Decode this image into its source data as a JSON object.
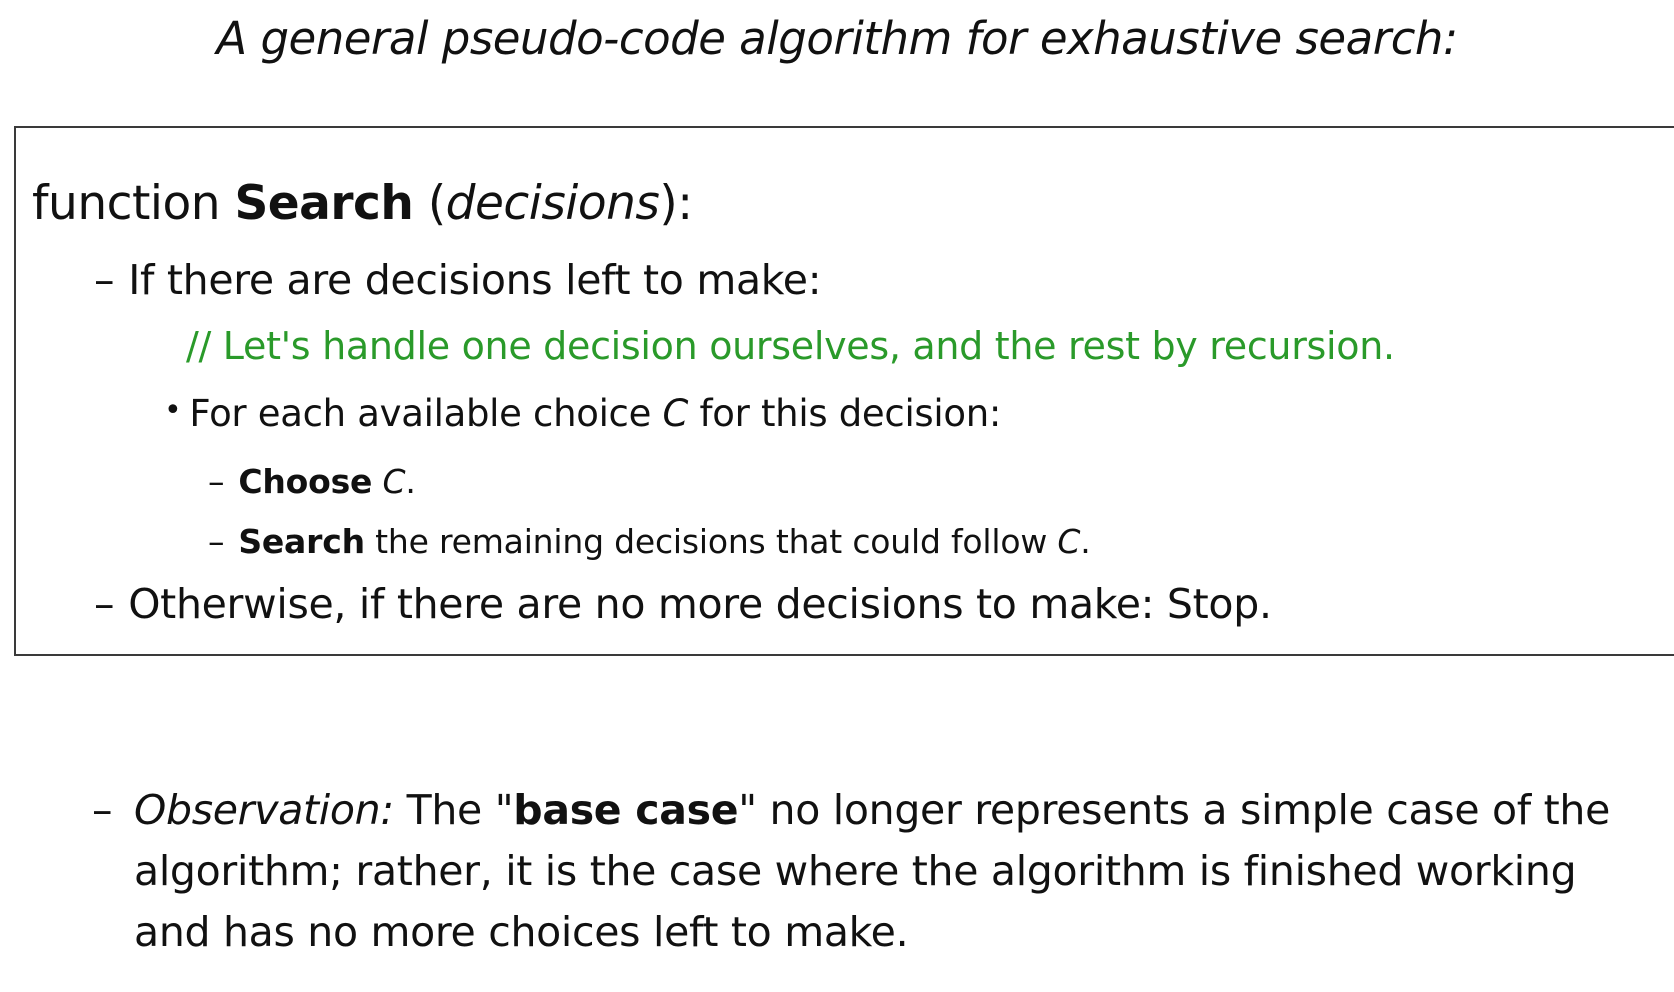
{
  "title": "A general pseudo-code algorithm for exhaustive search:",
  "code": {
    "function_keyword": "function ",
    "function_name": "Search",
    "paren_open": " (",
    "param": "decisions",
    "paren_close": "):",
    "dash": "–",
    "bullet": "•",
    "if_line": "If there are decisions left to make:",
    "comment": "// Let's handle one decision ourselves, and the rest by recursion.",
    "for_line_prefix": "For each available choice ",
    "for_var": "C",
    "for_line_suffix": " for this decision:",
    "choose_bold": "Choose",
    "choose_space": " ",
    "choose_var": "C",
    "choose_end": ".",
    "search_bold": "Search",
    "search_text": " the remaining decisions that could follow ",
    "search_var": "C",
    "search_end": ".",
    "otherwise_line": "Otherwise, if there are no more decisions to make:  Stop."
  },
  "observation": {
    "dash": "–",
    "label": "Observation:",
    "text_1": " The \"",
    "bold": "base case",
    "text_2": "\" no longer represents a simple case of the algorithm;  rather, it is the case where the algorithm is finished working and has no more choices left to make."
  }
}
